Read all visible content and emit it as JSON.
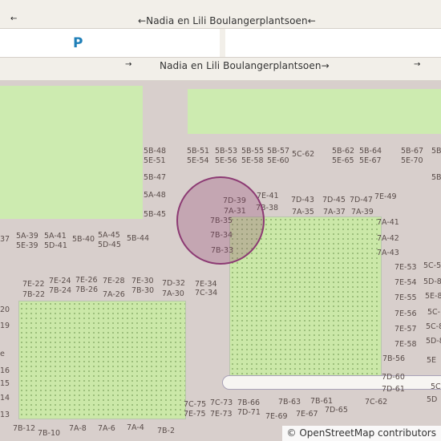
{
  "streets": {
    "top": {
      "name": "Nadia en Lili Boulangerplantsoen",
      "arrow_left": "←",
      "arrow_right": "←",
      "arrow_mid": "←"
    },
    "bottom": {
      "name": "Nadia en Lili Boulangerplantsoen",
      "arrow_left": "→",
      "arrow_right": "→",
      "arrow_end": "→"
    }
  },
  "parking_label": "P",
  "attribution": "© OpenStreetMap contributors",
  "colors": {
    "land": "#d8cfcc",
    "road": "#f2efe9",
    "park": "#cdebb0",
    "marker_fill": "rgba(145,60,110,0.28)",
    "marker_stroke": "#8c3a73",
    "parking": "#1f7fb8"
  },
  "house_numbers": [
    "5B-48",
    "5E-51",
    "5B-51",
    "5E-54",
    "5B-53",
    "5E-56",
    "5B-55",
    "5E-58",
    "5B-57",
    "5E-60",
    "5C-62",
    "5B-62",
    "5E-65",
    "5B-64",
    "5E-67",
    "5B-67",
    "5E-70",
    "5B",
    "5B-47",
    "5A-48",
    "5B-45",
    "5B",
    "7D-39",
    "7A-31",
    "7E-41",
    "7B-38",
    "7D-43",
    "7A-35",
    "7D-45",
    "7A-37",
    "7D-47",
    "7A-39",
    "7E-49",
    "7B-35",
    "7B-34",
    "7B-33",
    "7A-41",
    "7A-42",
    "7A-43",
    "37",
    "5A-39",
    "5E-39",
    "5A-41",
    "5D-41",
    "5B-40",
    "5A-45",
    "5D-45",
    "5B-44",
    "7E-22",
    "7B-22",
    "7E-24",
    "7B-24",
    "7E-26",
    "7B-26",
    "7E-28",
    "7A-26",
    "7E-30",
    "7B-30",
    "7D-32",
    "7A-30",
    "7E-34",
    "7C-34",
    "7E-53",
    "5C-5",
    "7E-54",
    "5D-8",
    "7E-55",
    "5C-",
    "7E-56",
    "5E-8",
    "7E-57",
    "5C-8",
    "7E-58",
    "5D-8",
    "7B-56",
    "5E",
    "7D-60",
    "7D-61",
    "5C",
    "20",
    "19",
    "e",
    "16",
    "15",
    "14",
    "13",
    "7C-75",
    "7E-75",
    "7C-73",
    "7E-73",
    "7B-66",
    "7D-71",
    "7B-63",
    "7E-69",
    "7B-61",
    "7E-67",
    "7D-65",
    "7C-62",
    "5D",
    "7B-12",
    "7B-10",
    "7A-8",
    "7A-6",
    "7A-4",
    "7B-2"
  ]
}
